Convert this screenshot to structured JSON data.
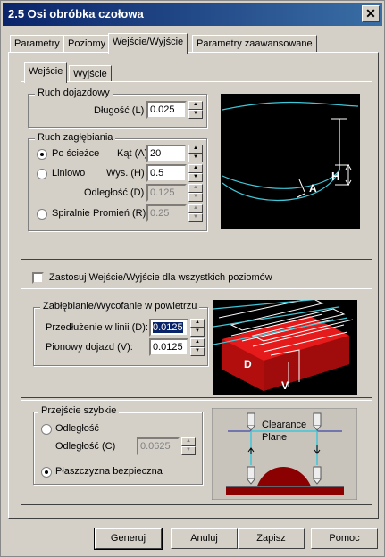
{
  "window": {
    "title": "2.5 Osi obróbka czołowa",
    "close": "✕"
  },
  "tabs": [
    "Parametry",
    "Poziomy",
    "Wejście/Wyjście",
    "Parametry zaawansowane"
  ],
  "subtabs": [
    "Wejście",
    "Wyjście"
  ],
  "ruch_dojazdowy": {
    "title": "Ruch dojazdowy",
    "length_label": "Długość (L)",
    "length_value": "0.025"
  },
  "ruch_zaglebiania": {
    "title": "Ruch zagłębiania",
    "opt_path": "Po ścieżce",
    "opt_linear": "Liniowo",
    "opt_spiral": "Spiralnie",
    "angle_label": "Kąt (A)",
    "angle_value": "20",
    "height_label": "Wys. (H)",
    "height_value": "0.5",
    "distance_label": "Odległość (D)",
    "distance_value": "0.125",
    "radius_label": "Promień (R)",
    "radius_value": "0.25"
  },
  "apply_all": "Zastosuj Wejście/Wyjście dla wszystkich poziomów",
  "air": {
    "title": "Zabłębianie/Wycofanie w powietrzu",
    "ext_label": "Przedłużenie w linii (D):",
    "ext_value": "0.0125",
    "vert_label": "Pionowy dojazd (V):",
    "vert_value": "0.0125"
  },
  "rapid": {
    "title": "Przejście szybkie",
    "opt_distance": "Odległość",
    "distance_label": "Odległość (C)",
    "distance_value": "0.0625",
    "opt_plane": "Płaszczyzna bezpieczna"
  },
  "diagram_labels": {
    "h": "H",
    "a": "A",
    "d": "D",
    "v": "V",
    "clearance": "Clearance",
    "plane": "Plane"
  },
  "buttons": {
    "generate": "Generuj",
    "cancel": "Anuluj",
    "save": "Zapisz",
    "help": "Pomoc"
  }
}
